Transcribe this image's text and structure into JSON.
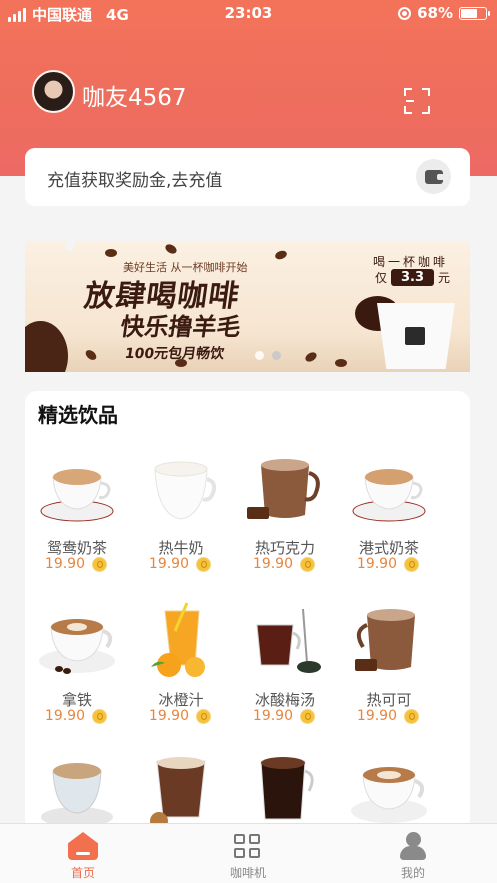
{
  "status_bar": {
    "carrier": "中国联通",
    "network": "4G",
    "time": "23:03",
    "battery": "68%",
    "battery_level": 0.68
  },
  "profile": {
    "username": "咖友4567"
  },
  "recharge": {
    "text": "充值获取奖励金,去充值"
  },
  "banner": {
    "tagline": "美好生活 从一杯咖啡开始",
    "line1": "放肆喝咖啡",
    "line2": "快乐撸羊毛",
    "line3": "100元包月畅饮",
    "right_line1": "喝一杯咖啡",
    "right_prefix": "仅",
    "right_price": "3.3",
    "right_unit": "元",
    "slide_count": 2,
    "active_slide": 2
  },
  "drinks": {
    "title": "精选饮品",
    "items": [
      {
        "name": "鸳鸯奶茶",
        "price": "19.90",
        "icon": "milk-tea-cup-icon"
      },
      {
        "name": "热牛奶",
        "price": "19.90",
        "icon": "hot-milk-cup-icon"
      },
      {
        "name": "热巧克力",
        "price": "19.90",
        "icon": "hot-chocolate-mug-icon"
      },
      {
        "name": "港式奶茶",
        "price": "19.90",
        "icon": "hk-milk-tea-cup-icon"
      },
      {
        "name": "拿铁",
        "price": "19.90",
        "icon": "latte-cup-icon"
      },
      {
        "name": "冰橙汁",
        "price": "19.90",
        "icon": "orange-juice-glass-icon"
      },
      {
        "name": "冰酸梅汤",
        "price": "19.90",
        "icon": "plum-drink-glass-icon"
      },
      {
        "name": "热可可",
        "price": "19.90",
        "icon": "hot-cocoa-mug-icon"
      },
      {
        "name": "",
        "price": "",
        "icon": "cappuccino-cup-icon"
      },
      {
        "name": "",
        "price": "",
        "icon": "mocha-glass-icon"
      },
      {
        "name": "",
        "price": "",
        "icon": "americano-glass-icon"
      },
      {
        "name": "",
        "price": "",
        "icon": "latte-art-cup-icon"
      }
    ]
  },
  "bottom_nav": {
    "items": [
      {
        "label": "首页",
        "icon": "home-icon",
        "active": true
      },
      {
        "label": "咖啡机",
        "icon": "grid-icon",
        "active": false
      },
      {
        "label": "我的",
        "icon": "user-icon",
        "active": false
      }
    ]
  },
  "colors": {
    "header_gradient_top": "#f3735a",
    "header_gradient_bottom": "#ec6a63",
    "price": "#e9843c",
    "nav_active": "#ef6a4f"
  }
}
